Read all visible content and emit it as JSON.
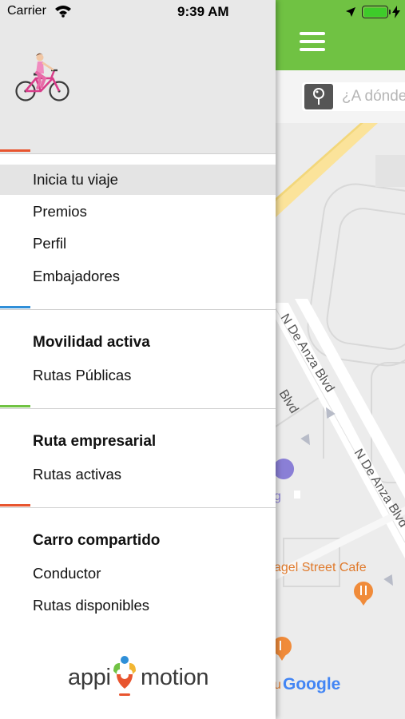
{
  "status_bar": {
    "carrier": "Carrier",
    "time": "9:39 AM",
    "battery_level": 1.0,
    "battery_color": "#3ecb2a"
  },
  "drawer": {
    "header_illustration": "cyclist-icon",
    "sections": [
      {
        "title": "",
        "accent_color": "#e8552f",
        "items": [
          {
            "label": "Inicia tu viaje",
            "selected": true
          },
          {
            "label": "Premios",
            "selected": false
          },
          {
            "label": "Perfil",
            "selected": false
          },
          {
            "label": "Embajadores",
            "selected": false
          }
        ]
      },
      {
        "title": "Movilidad activa",
        "accent_color": "#2f8fd8",
        "items": [
          {
            "label": "Rutas Públicas",
            "selected": false
          }
        ]
      },
      {
        "title": "Ruta empresarial",
        "accent_color": "#70c243",
        "items": [
          {
            "label": "Rutas activas",
            "selected": false
          }
        ]
      },
      {
        "title": "Carro compartido",
        "accent_color": "#e8552f",
        "items": [
          {
            "label": "Conductor",
            "selected": false
          },
          {
            "label": "Rutas disponibles",
            "selected": false
          }
        ]
      }
    ],
    "logo": {
      "left": "appi",
      "right": "motion"
    }
  },
  "map_panel": {
    "header_color": "#70c243",
    "menu_icon": "hamburger-menu-icon",
    "search": {
      "icon": "location-pin-icon",
      "placeholder": "¿A dónde vas?"
    },
    "map_labels": {
      "street_1": "N De Anza Blvd",
      "street_2": "N De Anza Blvd",
      "street_3": "Blvd",
      "poi_1": "g",
      "poi_2": "agel Street Cafe",
      "poi_3": "u",
      "attribution": "Google"
    },
    "poi_colors": {
      "gas": "#8a7fd6",
      "food": "#f08b3a"
    }
  }
}
